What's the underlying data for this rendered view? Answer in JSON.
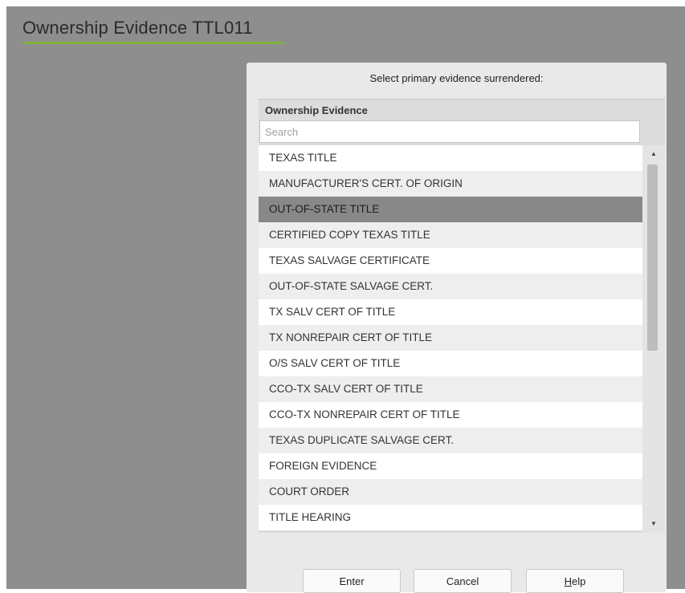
{
  "page": {
    "title": "Ownership Evidence TTL011"
  },
  "colors": {
    "background": "#8e8e8e",
    "title_underline": "#7fb23a",
    "dialog": "#e9e9e9",
    "selected_row": "#888888"
  },
  "dialog": {
    "prompt": "Select primary evidence surrendered:",
    "list_header": "Ownership Evidence",
    "search": {
      "placeholder": "Search",
      "value": ""
    },
    "items": [
      {
        "label": "TEXAS TITLE",
        "selected": false
      },
      {
        "label": "MANUFACTURER'S CERT. OF ORIGIN",
        "selected": false
      },
      {
        "label": "OUT-OF-STATE TITLE",
        "selected": true
      },
      {
        "label": "CERTIFIED COPY TEXAS TITLE",
        "selected": false
      },
      {
        "label": "TEXAS SALVAGE CERTIFICATE",
        "selected": false
      },
      {
        "label": "OUT-OF-STATE SALVAGE CERT.",
        "selected": false
      },
      {
        "label": "TX SALV CERT OF TITLE",
        "selected": false
      },
      {
        "label": "TX NONREPAIR CERT OF TITLE",
        "selected": false
      },
      {
        "label": "O/S SALV CERT OF TITLE",
        "selected": false
      },
      {
        "label": "CCO-TX SALV CERT OF TITLE",
        "selected": false
      },
      {
        "label": "CCO-TX NONREPAIR CERT OF TITLE",
        "selected": false
      },
      {
        "label": "TEXAS DUPLICATE SALVAGE CERT.",
        "selected": false
      },
      {
        "label": "FOREIGN EVIDENCE",
        "selected": false
      },
      {
        "label": "COURT ORDER",
        "selected": false
      },
      {
        "label": "TITLE HEARING",
        "selected": false
      }
    ],
    "scrollbar": {
      "up_icon": "scroll-up-arrow",
      "down_icon": "scroll-down-arrow"
    },
    "buttons": {
      "enter": "Enter",
      "cancel": "Cancel",
      "help_mnemonic": "H",
      "help_rest": "elp"
    }
  }
}
